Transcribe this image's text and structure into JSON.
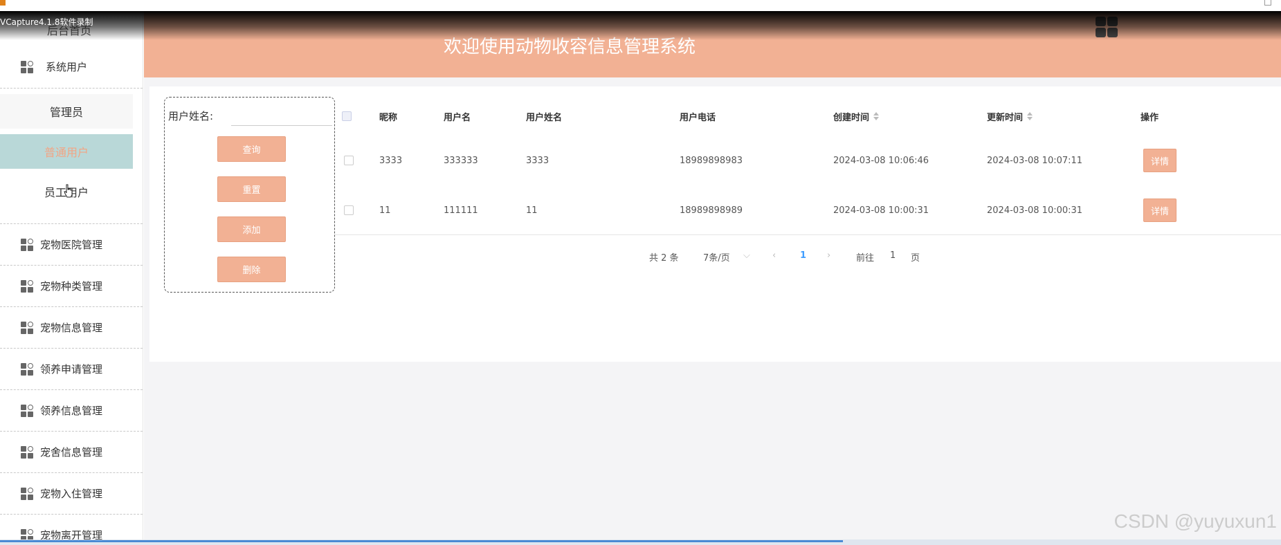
{
  "recorder_label": "VCapture4.1.8软件录制",
  "watermark": "CSDN @yuyuxun1",
  "colors": {
    "accent": "#f2b194",
    "active_bg": "#b9d8d8",
    "active_text": "#f2a584",
    "page_link": "#409eff"
  },
  "sidebar": {
    "top_ghost": "后台首页",
    "system_users": {
      "label": "系统用户",
      "icon": "grid-icon",
      "children": [
        {
          "label": "管理员",
          "active": false
        },
        {
          "label": "普通用户",
          "active": true
        },
        {
          "label": "员工用户",
          "active": false
        }
      ]
    },
    "items": [
      {
        "label": "宠物医院管理",
        "icon": "grid-icon"
      },
      {
        "label": "宠物种类管理",
        "icon": "grid-icon"
      },
      {
        "label": "宠物信息管理",
        "icon": "grid-icon"
      },
      {
        "label": "领养申请管理",
        "icon": "grid-icon"
      },
      {
        "label": "领养信息管理",
        "icon": "grid-icon"
      },
      {
        "label": "宠舍信息管理",
        "icon": "grid-icon"
      },
      {
        "label": "宠物入住管理",
        "icon": "grid-icon"
      },
      {
        "label": "宠物离开管理",
        "icon": "grid-icon"
      }
    ]
  },
  "header": {
    "title": "欢迎使用动物收容信息管理系统"
  },
  "search": {
    "label": "用户姓名:",
    "value": "",
    "buttons": {
      "query": "查询",
      "reset": "重置",
      "add": "添加",
      "delete": "删除"
    }
  },
  "table": {
    "columns": [
      "昵称",
      "用户名",
      "用户姓名",
      "用户电话",
      "创建时间",
      "更新时间",
      "操作"
    ],
    "rows": [
      {
        "nickname": "3333",
        "username": "333333",
        "name": "3333",
        "phone": "18989898983",
        "created": "2024-03-08 10:06:46",
        "updated": "2024-03-08 10:07:11",
        "action": "详情"
      },
      {
        "nickname": "11",
        "username": "111111",
        "name": "11",
        "phone": "18989898989",
        "created": "2024-03-08 10:00:31",
        "updated": "2024-03-08 10:00:31",
        "action": "详情"
      }
    ]
  },
  "pagination": {
    "total": "共 2 条",
    "page_size": "7条/页",
    "current_page": "1",
    "goto_prefix": "前往",
    "goto_value": "1",
    "goto_suffix": "页"
  }
}
